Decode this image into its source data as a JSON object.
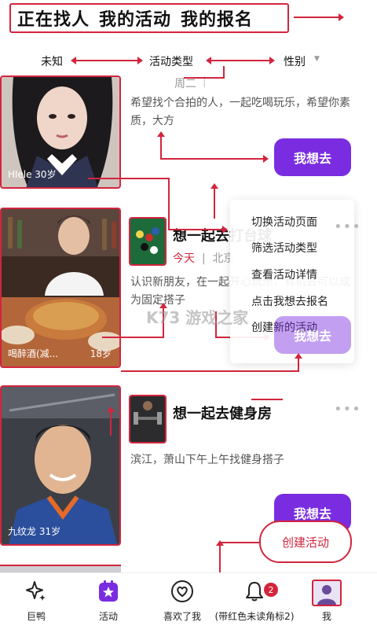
{
  "top_tabs": [
    "正在找人",
    "我的活动",
    "我的报名"
  ],
  "filters": {
    "unknown": "未知",
    "activity_type": "活动类型",
    "gender": "性别"
  },
  "cards": [
    {
      "date_partial": "周二",
      "description": "希望找个合拍的人，一起吃喝玩乐，希望你素质，大方",
      "go_label": "我想去",
      "person": {
        "name": "Hlele",
        "age": "30岁"
      }
    },
    {
      "title": "想一起去打台球",
      "date": "今天",
      "location": "北京",
      "description": "认识新朋友，在一起开心玩乐，有机会可以成为固定搭子",
      "go_label": "我想去",
      "person": {
        "name": "喝醉酒(减...",
        "age": "18岁"
      }
    },
    {
      "title": "想一起去健身房",
      "description": "滨江，萧山下午上午找健身搭子",
      "go_label": "我想去",
      "person": {
        "name": "九纹龙",
        "age": "31岁"
      }
    }
  ],
  "menu_items": [
    "切换活动页面",
    "筛选活动类型",
    "查看活动详情",
    "点击我想去报名",
    "创建新的活动"
  ],
  "create_label": "创建活动",
  "watermark": "K73 游戏之家",
  "nav": [
    {
      "label": "巨鸭",
      "icon": "sparkle-icon"
    },
    {
      "label": "活动",
      "icon": "activity-star-icon"
    },
    {
      "label": "喜欢了我",
      "icon": "heart-icon"
    },
    {
      "label": "(带红色未读角标2)",
      "icon": "bell-icon",
      "badge": "2"
    },
    {
      "label": "我",
      "icon": "avatar-icon"
    }
  ],
  "colors": {
    "accent": "#7a2de0",
    "annotation": "#d2253d"
  }
}
